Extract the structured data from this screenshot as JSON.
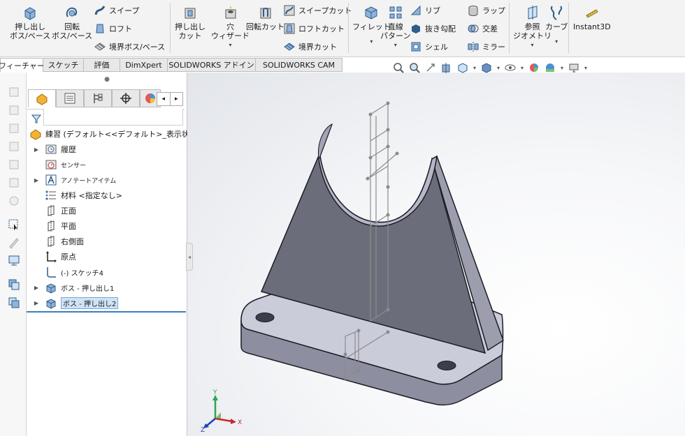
{
  "ribbon": {
    "boss_extrude": [
      "押し出し",
      "ボス/ベース"
    ],
    "revolve_boss": [
      "回転",
      "ボス/ベース"
    ],
    "sweep": "スイープ",
    "loft": "ロフト",
    "boundary_boss": "境界ボス/ベース",
    "extruded_cut": [
      "押し出し",
      "カット"
    ],
    "hole_wizard": [
      "穴",
      "ウィザード"
    ],
    "revolved_cut": "回転カット",
    "swept_cut": "スイープカット",
    "lofted_cut": "ロフトカット",
    "boundary_cut": "境界カット",
    "fillet": "フィレット",
    "linear_pattern": [
      "直線",
      "パターン"
    ],
    "rib": "リブ",
    "draft": "抜き勾配",
    "shell": "シェル",
    "wrap": "ラップ",
    "intersect": "交差",
    "mirror": "ミラー",
    "ref_geometry": [
      "参照",
      "ジオメトリ"
    ],
    "curves": "カーブ",
    "instant3d": "Instant3D"
  },
  "tabs": [
    "フィーチャー",
    "スケッチ",
    "評価",
    "DimXpert",
    "SOLIDWORKS アドイン",
    "SOLIDWORKS CAM"
  ],
  "feature_tree": {
    "root": "練習 (デフォルト<<デフォルト>_表示状態 1>)",
    "items": [
      {
        "label": "履歴",
        "icon": "history-icon",
        "expandable": true
      },
      {
        "label": "センサー",
        "icon": "sensor-icon",
        "expandable": false
      },
      {
        "label": "アノテートアイテム",
        "icon": "annotations-icon",
        "expandable": true
      },
      {
        "label": "材料 <指定なし>",
        "icon": "material-icon",
        "expandable": false
      },
      {
        "label": "正面",
        "icon": "plane-icon",
        "expandable": false
      },
      {
        "label": "平面",
        "icon": "plane-icon",
        "expandable": false
      },
      {
        "label": "右側面",
        "icon": "plane-icon",
        "expandable": false
      },
      {
        "label": "原点",
        "icon": "origin-icon",
        "expandable": false
      },
      {
        "label": "(-) スケッチ4",
        "icon": "sketch-icon",
        "expandable": false
      },
      {
        "label": "ボス - 押し出し1",
        "icon": "extrude-feature-icon",
        "expandable": true
      },
      {
        "label": "ボス - 押し出し2",
        "icon": "extrude-feature-icon",
        "expandable": true,
        "selected": true
      }
    ]
  },
  "triad": {
    "x": "X",
    "y": "Y",
    "z": "Z"
  },
  "colors": {
    "accent": "#3a7fc1",
    "part_face": "#6b6e7a",
    "part_top": "#c9cad8",
    "part_side": "#8d8fa0",
    "edge": "#1c1c26",
    "selection": "#cfe3f7"
  }
}
